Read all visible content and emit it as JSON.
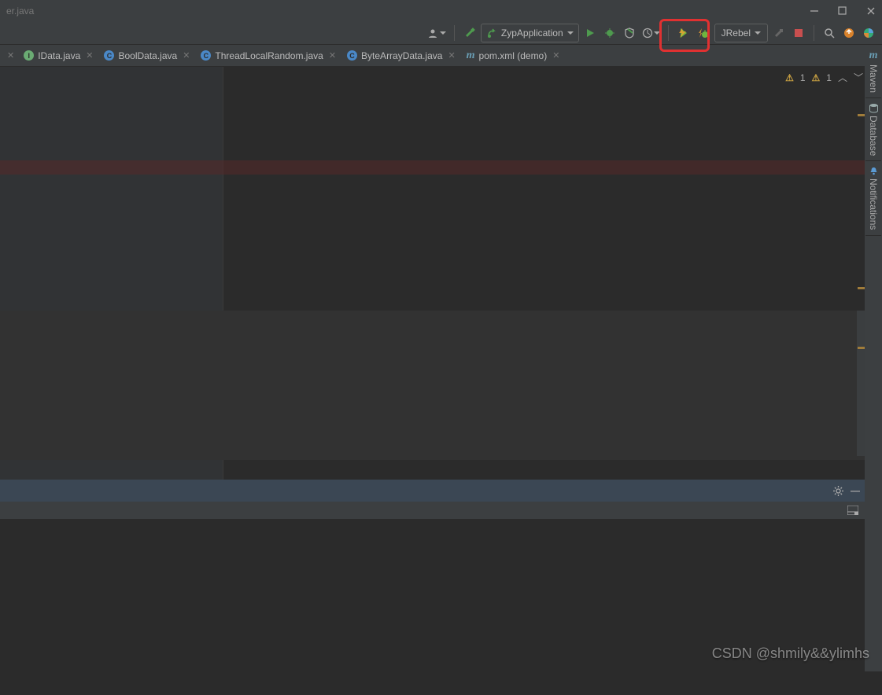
{
  "titlebar": {
    "title": "er.java"
  },
  "toolbar": {
    "run_config": "ZypApplication",
    "jrebel": "JRebel"
  },
  "tabs": [
    {
      "icon": "green",
      "letter": "I",
      "label": "IData.java"
    },
    {
      "icon": "blue",
      "letter": "C",
      "label": "BoolData.java"
    },
    {
      "icon": "blue",
      "letter": "C",
      "label": "ThreadLocalRandom.java"
    },
    {
      "icon": "blue",
      "letter": "C",
      "label": "ByteArrayData.java"
    },
    {
      "icon": "maven",
      "letter": "m",
      "label": "pom.xml (demo)"
    }
  ],
  "inspections": {
    "warn1": "1",
    "warn2": "1"
  },
  "right_tools": {
    "maven": "Maven",
    "database": "Database",
    "notifications": "Notifications"
  },
  "watermark": "CSDN @shmily&&ylimhs"
}
